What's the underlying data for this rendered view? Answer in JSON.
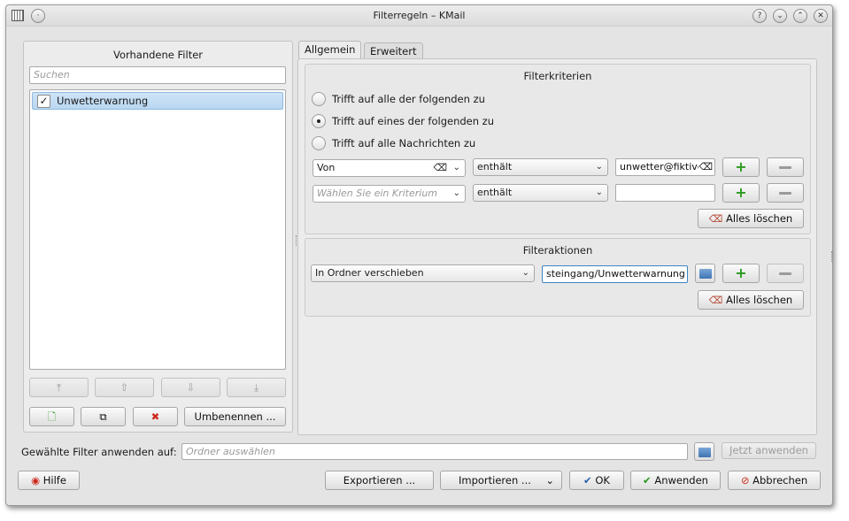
{
  "window": {
    "title": "Filterregeln – KMail"
  },
  "left": {
    "title": "Vorhandene Filter",
    "search_placeholder": "Suchen",
    "filters": [
      {
        "name": "Unwetterwarnung",
        "checked": true
      }
    ],
    "rename_label": "Umbenennen ..."
  },
  "tabs": [
    {
      "label": "Allgemein",
      "active": true
    },
    {
      "label": "Erweitert",
      "active": false
    }
  ],
  "criteria": {
    "title": "Filterkriterien",
    "options": [
      {
        "label": "Trifft auf alle der folgenden zu",
        "checked": false
      },
      {
        "label": "Trifft auf eines der folgenden zu",
        "checked": true
      },
      {
        "label": "Trifft auf alle Nachrichten zu",
        "checked": false
      }
    ],
    "rows": [
      {
        "field": "Von",
        "field_placeholder": "",
        "op": "enthält",
        "value": "unwetter@fiktive"
      },
      {
        "field": "",
        "field_placeholder": "Wählen Sie ein Kriterium",
        "op": "enthält",
        "value": ""
      }
    ],
    "clear_label": "Alles löschen"
  },
  "actions": {
    "title": "Filteraktionen",
    "action": "In Ordner verschieben",
    "folder_value": "steingang/Unwetterwarnung",
    "clear_label": "Alles löschen"
  },
  "apply": {
    "label": "Gewählte Filter anwenden auf:",
    "placeholder": "Ordner auswählen",
    "button": "Jetzt anwenden"
  },
  "footer": {
    "help": "Hilfe",
    "export": "Exportieren ...",
    "import": "Importieren ...",
    "ok": "OK",
    "apply": "Anwenden",
    "cancel": "Abbrechen"
  },
  "colors": {
    "selection": "#b9d7f1",
    "plus": "#2a9a1e",
    "cancel": "#cc2a1e"
  }
}
